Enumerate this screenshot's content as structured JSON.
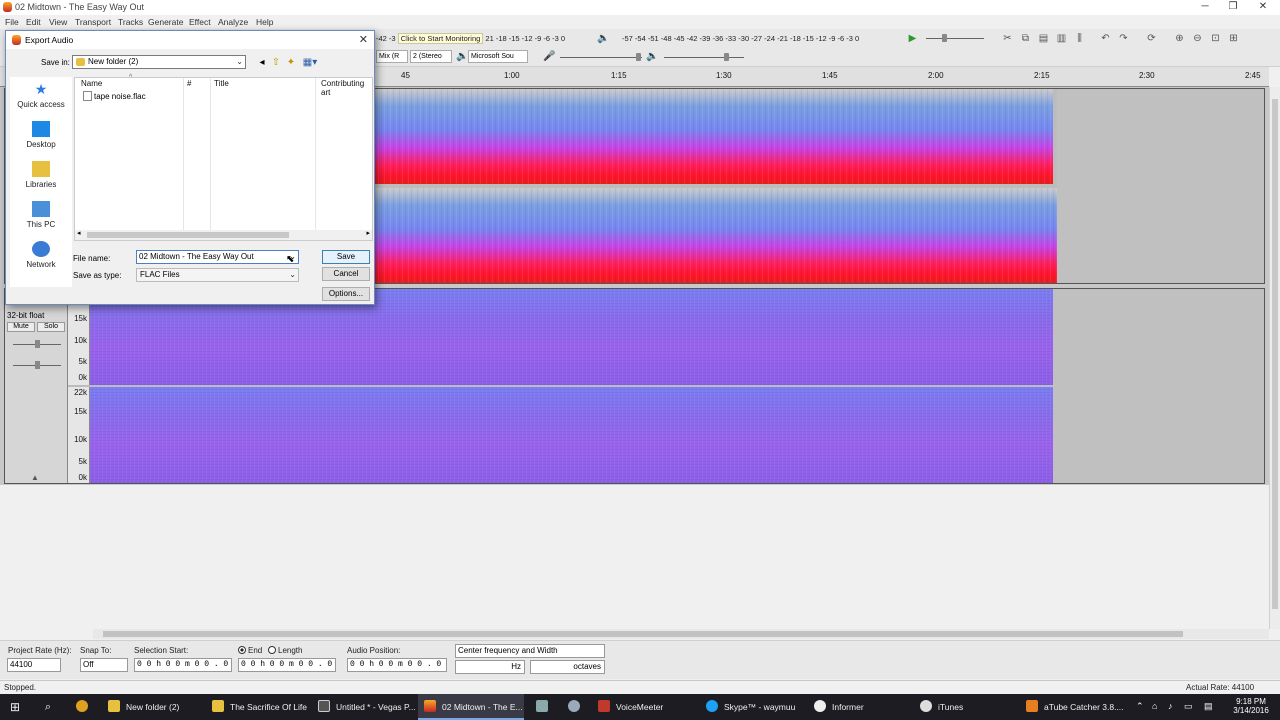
{
  "window": {
    "title": "02 Midtown - The Easy Way Out"
  },
  "menu": [
    "File",
    "Edit",
    "View",
    "Transport",
    "Tracks",
    "Generate",
    "Effect",
    "Analyze",
    "Help"
  ],
  "toolbar": {
    "record_meter_button": "Click to Start Monitoring",
    "record_meter_scale": "-42 -3",
    "record_meter_tail": "21 -18 -15 -12 -9 -6 -3 0",
    "playback_meter_scale": "-57 -54 -51 -48 -45 -42 -39 -36 -33 -30 -27 -24 -21 -18 -15 -12 -9 -6 -3 0",
    "recording_channels": "2 (Stereo",
    "input_source": "Mix (R",
    "output_device": "Microsoft Sou"
  },
  "ruler": {
    "ticks": [
      "45",
      "1:00",
      "1:15",
      "1:30",
      "1:45",
      "2:00",
      "2:15",
      "2:30",
      "2:45"
    ]
  },
  "tracks": {
    "noise_track": {
      "format": "32-bit float",
      "mute": "Mute",
      "solo": "Solo",
      "scale_a": [
        "15k",
        "10k",
        "5k",
        "0k"
      ],
      "scale_b": [
        "22k",
        "15k",
        "10k",
        "5k",
        "0k"
      ]
    }
  },
  "selection_toolbar": {
    "project_rate_label": "Project Rate (Hz):",
    "project_rate_value": "44100",
    "snap_to_label": "Snap To:",
    "snap_to_value": "Off",
    "selection_start_label": "Selection Start:",
    "selection_start_value": "0 0 h 0 0 m 0 0 . 0 0 0 s",
    "end_label": "End",
    "length_label": "Length",
    "end_value": "0 0 h 0 0 m 0 0 . 0 0 0 s",
    "audio_position_label": "Audio Position:",
    "audio_position_value": "0 0 h 0 0 m 0 0 . 0 0 0 s",
    "spectral_mode": "Center frequency and Width",
    "hz_unit": "Hz",
    "octaves_unit": "octaves"
  },
  "status": {
    "left": "Stopped.",
    "right": "Actual Rate: 44100"
  },
  "dialog": {
    "title": "Export Audio",
    "save_in_label": "Save in:",
    "save_in_value": "New folder (2)",
    "places": [
      "Quick access",
      "Desktop",
      "Libraries",
      "This PC",
      "Network"
    ],
    "columns": [
      "Name",
      "#",
      "Title",
      "Contributing art"
    ],
    "files": [
      "tape noise.flac"
    ],
    "file_name_label": "File name:",
    "file_name_value": "02 Midtown - The Easy Way Out",
    "save_as_type_label": "Save as type:",
    "save_as_type_value": "FLAC Files",
    "save_button": "Save",
    "cancel_button": "Cancel",
    "options_button": "Options..."
  },
  "taskbar": {
    "items": [
      "New folder (2)",
      "The Sacrifice Of Life",
      "Untitled * - Vegas P...",
      "02 Midtown - The E...",
      "VoiceMeeter",
      "Skype™ - waymuu",
      "Informer",
      "iTunes",
      "aTube Catcher 3.8...."
    ],
    "clock_time": "9:18 PM",
    "clock_date": "3/14/2016"
  },
  "colors": {
    "accent": "#4a7fc8",
    "spectrogram_hot": "#ff1e50",
    "spectrogram_cool": "#6f8ff0",
    "noise_purple": "#8c66e8"
  }
}
